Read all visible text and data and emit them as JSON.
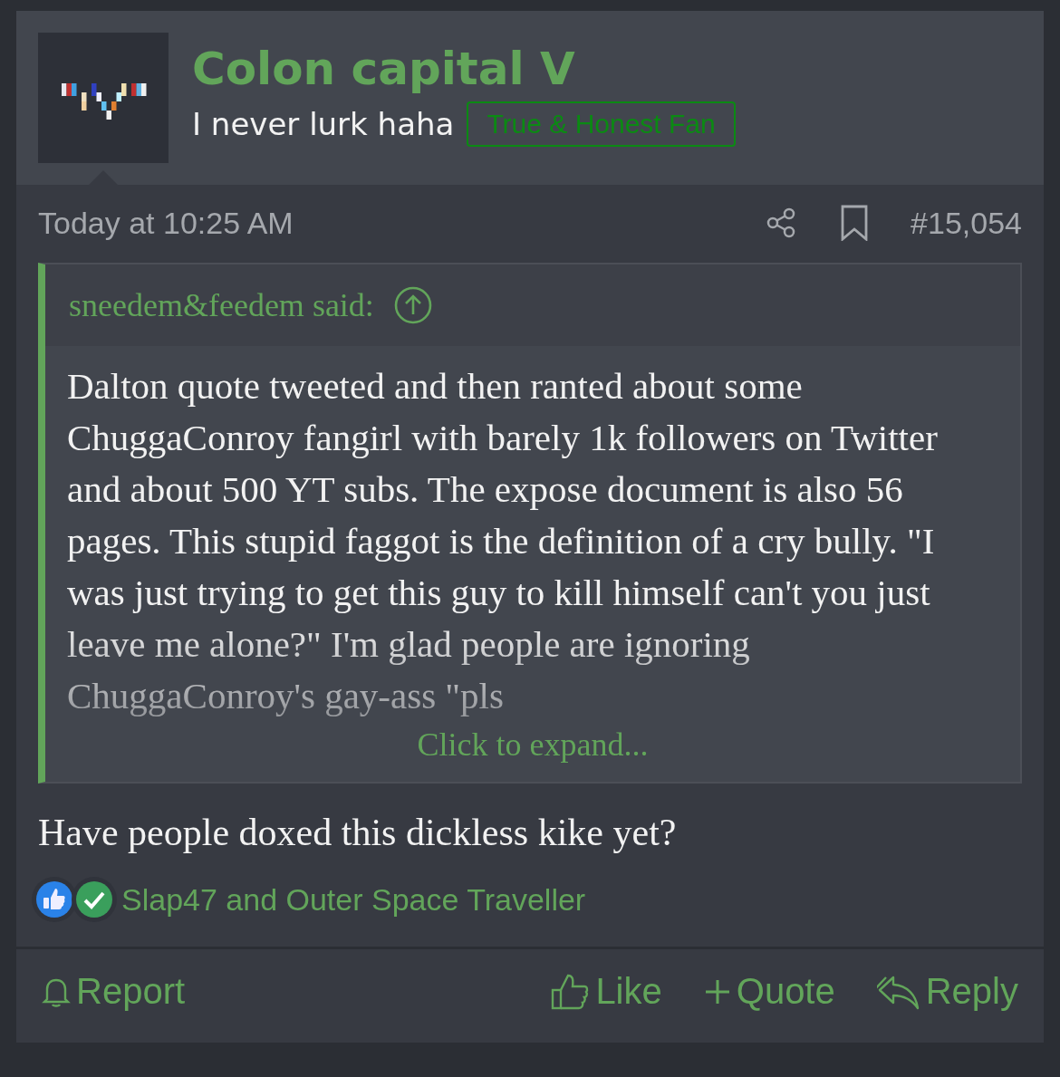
{
  "user": {
    "name": "Colon capital V",
    "title": "I never lurk haha",
    "banner": "True & Honest Fan"
  },
  "post": {
    "time": "Today at 10:25 AM",
    "number": "#15,054"
  },
  "quote": {
    "author": "sneedem&feedem said:",
    "text": "Dalton quote tweeted and then ranted about some ChuggaConroy fangirl with barely 1k followers on Twitter and about 500 YT subs. The expose document is also 56 pages. This stupid faggot is the definition of a cry bully. \"I was just trying to get this guy to kill himself can't you just leave me alone?\" I'm glad people are ignoring ChuggaConroy's gay-ass \"pls",
    "expand": "Click to expand..."
  },
  "message": "Have people doxed this dickless kike yet?",
  "reactions": {
    "icons": [
      {
        "kind": "like"
      },
      {
        "kind": "agree"
      }
    ],
    "users": "Slap47 and Outer Space Traveller"
  },
  "actions": {
    "report": "Report",
    "buttons": [
      {
        "kind": "like",
        "label": "Like"
      },
      {
        "kind": "quote",
        "label": "Quote"
      },
      {
        "kind": "reply",
        "label": "Reply"
      }
    ]
  }
}
